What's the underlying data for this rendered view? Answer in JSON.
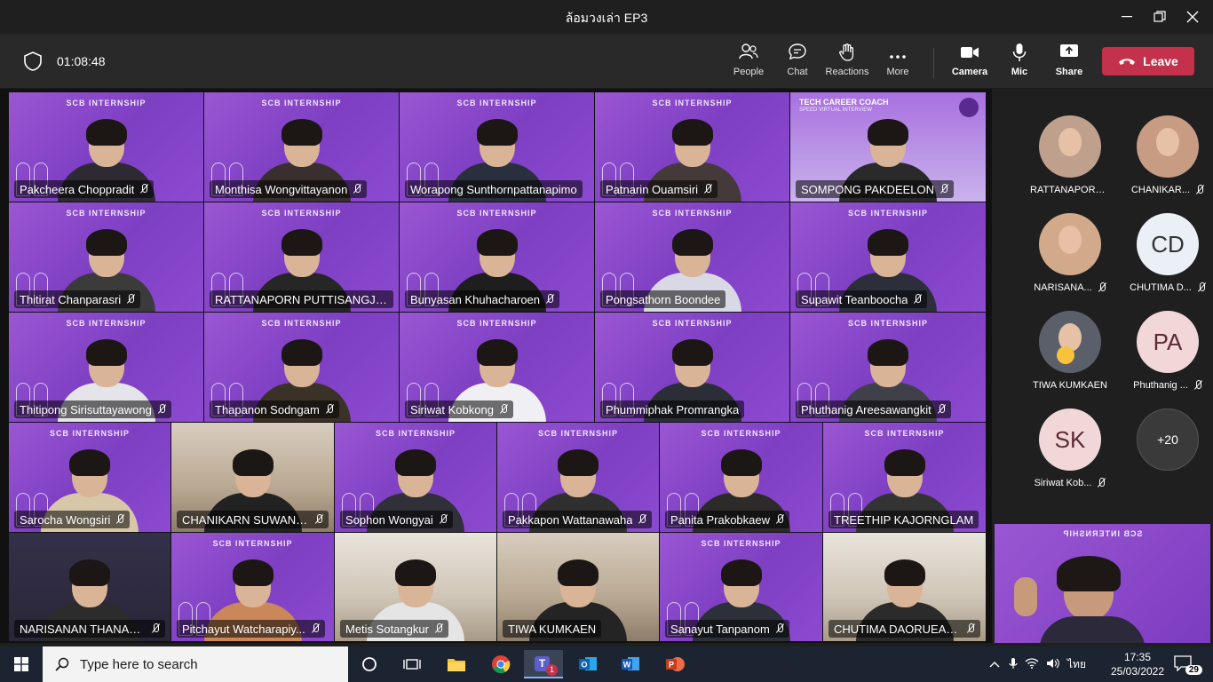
{
  "window": {
    "title": "ล้อมวงเล่า EP3"
  },
  "toolbar": {
    "timer": "01:08:48",
    "buttons": {
      "people": "People",
      "chat": "Chat",
      "reactions": "Reactions",
      "more": "More",
      "camera": "Camera",
      "mic": "Mic",
      "share": "Share"
    },
    "leave_label": "Leave"
  },
  "grid": {
    "banner": "SCB INTERNSHIP",
    "coach_banner": "TECH CAREER COACH",
    "coach_sub": "SPEED VIRTUAL INTERVIEW",
    "participants": [
      "Pakcheera Choppradit",
      "Monthisa Wongvittayanon",
      "Worapong Sunthornpattanapimo",
      "Patnarin Ouamsiri",
      "SOMPONG PAKDEELON",
      "Thitirat Chanparasri",
      "RATTANAPORN PUTTISANGJUN",
      "Bunyasan Khuhacharoen",
      "Pongsathorn Boondee",
      "Supawit Teanboocha",
      "Thitipong Sirisuttayawong",
      "Thapanon Sodngam",
      "Siriwat Kobkong",
      "Phummiphak Promrangka",
      "Phuthanig Areesawangkit",
      "Sarocha Wongsiri",
      "CHANIKARN SUWANN...",
      "Sophon Wongyai",
      "Pakkapon Wattanawaha",
      "Panita Prakobkaew",
      "TREETHIP KAJORNGLAM",
      "NARISANAN THANAKI...",
      "Pitchayut Watcharapiy...",
      "Metis Sotangkur",
      "TIWA KUMKAEN",
      "Sanayut Tanpanom",
      "CHUTIMA DAORUEANG"
    ]
  },
  "side": {
    "avatars": [
      {
        "name": "RATTANAPORN...",
        "initials": "",
        "muted": false
      },
      {
        "name": "CHANIKAR...",
        "initials": "",
        "muted": true
      },
      {
        "name": "NARISANA...",
        "initials": "",
        "muted": true
      },
      {
        "name": "CHUTIMA D...",
        "initials": "CD",
        "muted": true
      },
      {
        "name": "TIWA KUMKAEN",
        "initials": "",
        "muted": false
      },
      {
        "name": "Phuthanig ...",
        "initials": "PA",
        "muted": true
      },
      {
        "name": "Siriwat Kob...",
        "initials": "SK",
        "muted": true
      },
      {
        "name": "",
        "initials": "+20",
        "muted": false
      }
    ],
    "self_banner": "SCB INTERNSHIP"
  },
  "taskbar": {
    "search_placeholder": "Type here to search",
    "teams_badge": "1",
    "language": "ไทย",
    "time": "17:35",
    "date": "25/03/2022",
    "notification_count": "29"
  }
}
